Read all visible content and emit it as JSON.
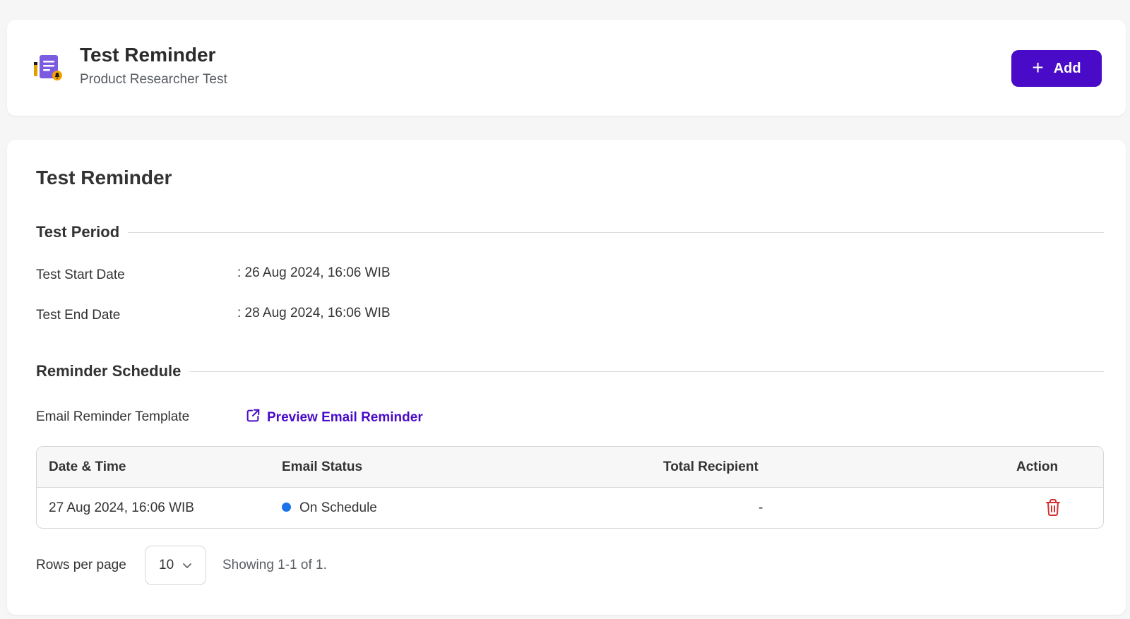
{
  "header": {
    "title": "Test Reminder",
    "subtitle": "Product Researcher Test",
    "icon": "document-bell-icon",
    "add_label": "Add"
  },
  "main": {
    "title": "Test Reminder",
    "test_period": {
      "heading": "Test Period",
      "start_label": "Test Start Date",
      "start_value": ": 26 Aug 2024, 16:06 WIB",
      "end_label": "Test End Date",
      "end_value": ": 28 Aug 2024, 16:06 WIB"
    },
    "reminder_schedule": {
      "heading": "Reminder Schedule",
      "template_label": "Email Reminder Template",
      "preview_link": "Preview Email Reminder"
    },
    "table": {
      "columns": [
        "Date & Time",
        "Email Status",
        "Total Recipient",
        "Action"
      ],
      "rows": [
        {
          "date_time": "27 Aug 2024, 16:06 WIB",
          "status": "On Schedule",
          "total_recipient": "-"
        }
      ]
    },
    "pagination": {
      "rows_per_page_label": "Rows per page",
      "rows_per_page_value": "10",
      "showing": "Showing 1-1 of 1."
    }
  },
  "colors": {
    "brand": "#4a0bc8",
    "status_on_schedule": "#1a73e8",
    "delete": "#d32f2f"
  }
}
